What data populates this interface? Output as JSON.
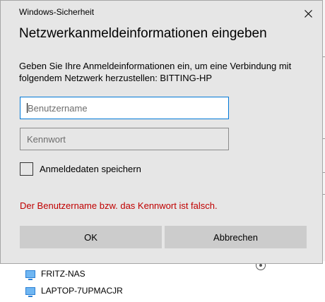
{
  "dialog": {
    "window_title": "Windows-Sicherheit",
    "heading": "Netzwerkanmeldeinformationen eingeben",
    "description": "Geben Sie Ihre Anmeldeinformationen ein, um eine Verbindung mit folgendem Netzwerk herzustellen: BITTING-HP",
    "username_placeholder": "Benutzername",
    "username_value": "",
    "password_placeholder": "Kennwort",
    "remember_label": "Anmeldedaten speichern",
    "remember_checked": false,
    "error_message": "Der Benutzername bzw. das Kennwort ist falsch.",
    "ok_label": "OK",
    "cancel_label": "Abbrechen"
  },
  "background": {
    "network_items": [
      {
        "label": "FRITZ-NAS",
        "icon": "computer-icon"
      },
      {
        "label": "LAPTOP-7UPMACJR",
        "icon": "computer-icon"
      }
    ]
  },
  "colors": {
    "dialog_bg": "#e6e6e6",
    "focus_border": "#0078d7",
    "error_text": "#c00000",
    "button_bg": "#cccccc"
  }
}
